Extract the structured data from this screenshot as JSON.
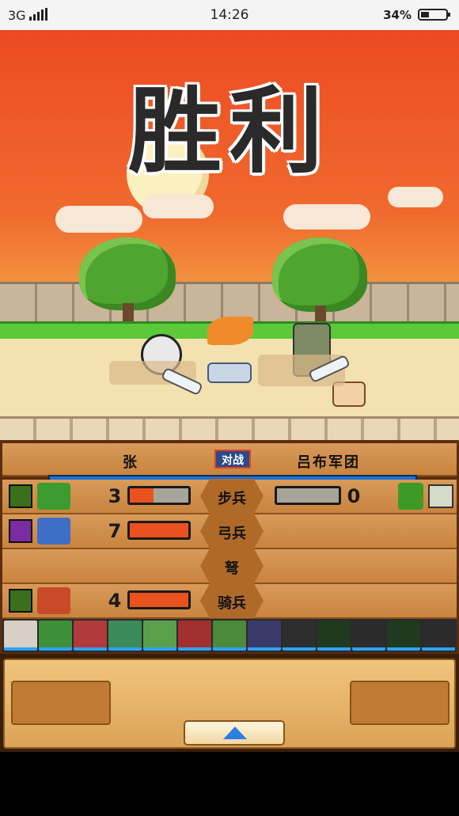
{
  "status_bar": {
    "network": "3G",
    "time": "14:26",
    "battery_percent": "34%",
    "battery_level": 0.34
  },
  "scene": {
    "title": "胜利"
  },
  "battle_panel": {
    "left_commander": "张",
    "vs_label": "对战",
    "right_commander": "吕布军团",
    "rows": [
      {
        "type": "步兵",
        "left_count": "3",
        "left_fill": 0.4,
        "right_count": "0",
        "right_fill": 0
      },
      {
        "type": "弓兵",
        "left_count": "7",
        "left_fill": 1.0
      },
      {
        "type": "弩"
      },
      {
        "type": "骑兵",
        "left_count": "4",
        "left_fill": 1.0
      }
    ]
  },
  "colors": {
    "sky": "#ec4a22",
    "accent_blue": "#2b7ee6",
    "panel_wood": "#d89a5a",
    "bar_fill": "#e9521e"
  }
}
